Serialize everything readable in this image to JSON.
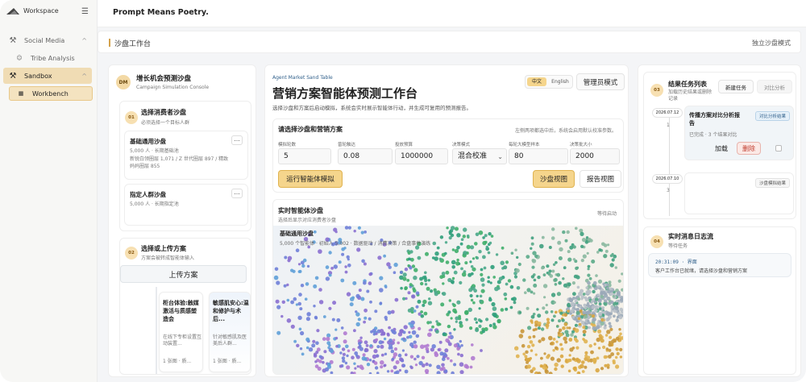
{
  "app": {
    "workspace": "Workspace",
    "title": "Prompt Means Poetry."
  },
  "sidebar": {
    "items": [
      {
        "label": "Social Media"
      },
      {
        "label": "Tribe Analysis"
      },
      {
        "label": "Sandbox"
      },
      {
        "label": "Workbench"
      }
    ]
  },
  "header": {
    "title": "沙盘工作台",
    "right": "独立沙盘模式"
  },
  "left_panel": {
    "title": "增长机会预测沙盘",
    "subtitle": "Campaign Simulation Console",
    "avatar": "DM",
    "step1": {
      "num": "01",
      "title": "选择消费者沙盘",
      "desc": "必须选择一个目标人群"
    },
    "sandbox_a": {
      "title": "基础通用沙盘",
      "count": "5,000 人 · 长期基础池",
      "desc": "新锐白领圈层 1,071 / Z 世代圈层 897 / 精致妈妈圈层 855"
    },
    "sandbox_b": {
      "title": "指定人群沙盘",
      "count": "5,000 人 · 长期指定池"
    },
    "step2": {
      "num": "02",
      "title": "选择或上传方案",
      "desc": "方案会被转成智能体输入"
    },
    "upload_label": "上传方案",
    "plan_a": {
      "title": "柜台体验:触媒激活与质感塑造会",
      "desc": "在线下专柜设置互动装置...",
      "meta": "1 张图 · 质..."
    },
    "plan_b": {
      "title": "敏感肌安心:温和修护与术后...",
      "desc": "针对敏感肌及医美后人群...",
      "meta": "1 张图 · 质..."
    }
  },
  "center": {
    "tag": "Agent Market Sand Table",
    "title": "营销方案智能体预测工作台",
    "desc": "选择沙盘和方案后启动模拟，系统会实时展示智能体行动，并生成可复用的预测报告。",
    "lang_zh": "中文",
    "lang_en": "English",
    "admin_mode": "管理员模式",
    "config": {
      "title": "请选择沙盘和营销方案",
      "hint": "左侧两项都选中后，系统会启用默认校准参数。",
      "fields": [
        {
          "label": "模拟轮数",
          "value": "5"
        },
        {
          "label": "曾轮触达",
          "value": "0.08"
        },
        {
          "label": "投放预算",
          "value": "1000000"
        },
        {
          "label": "决策模式",
          "value": "混合校准"
        },
        {
          "label": "每轮大模型样本",
          "value": "80"
        },
        {
          "label": "决策批大小",
          "value": "2000"
        }
      ],
      "run_label": "运行智能体模拟",
      "sandbox_view": "沙盘视图",
      "report_view": "报告视图"
    },
    "live": {
      "title": "实时智能体沙盘",
      "desc": "选择后显示对应消费者沙盘",
      "status": "等待启动",
      "overlay_title": "基础通用沙盘",
      "overlay_meta": "5,000 个智能体 · 初始人 5,002 · 数据驱动 / 消费决策 / 合盘事件演练"
    }
  },
  "right": {
    "step3": {
      "num": "03",
      "title": "结果任务列表",
      "desc": "加载历史结果或删除记录"
    },
    "new_task": "新建任务",
    "compare": "对比分析",
    "task1": {
      "date": "2026.07.12",
      "count": "1",
      "title": "传播方案对比分析报告",
      "tag": "对比分析结果",
      "meta": "已完成 · 3 个结果对比",
      "load": "加载",
      "delete": "删除"
    },
    "task2": {
      "date": "2026.07.10",
      "count": "3",
      "tag": "沙盘模拟结果"
    },
    "step4": {
      "num": "04",
      "title": "实时消息日志流",
      "desc": "等待任务"
    },
    "log": {
      "time": "20:31:09",
      "source": "界面",
      "text": "客户工作台已就绪，请选择沙盘和营销方案"
    }
  },
  "colors": {
    "accent": "#f5d58c",
    "accent_border": "#e0b350",
    "delete": "#c0392b"
  }
}
